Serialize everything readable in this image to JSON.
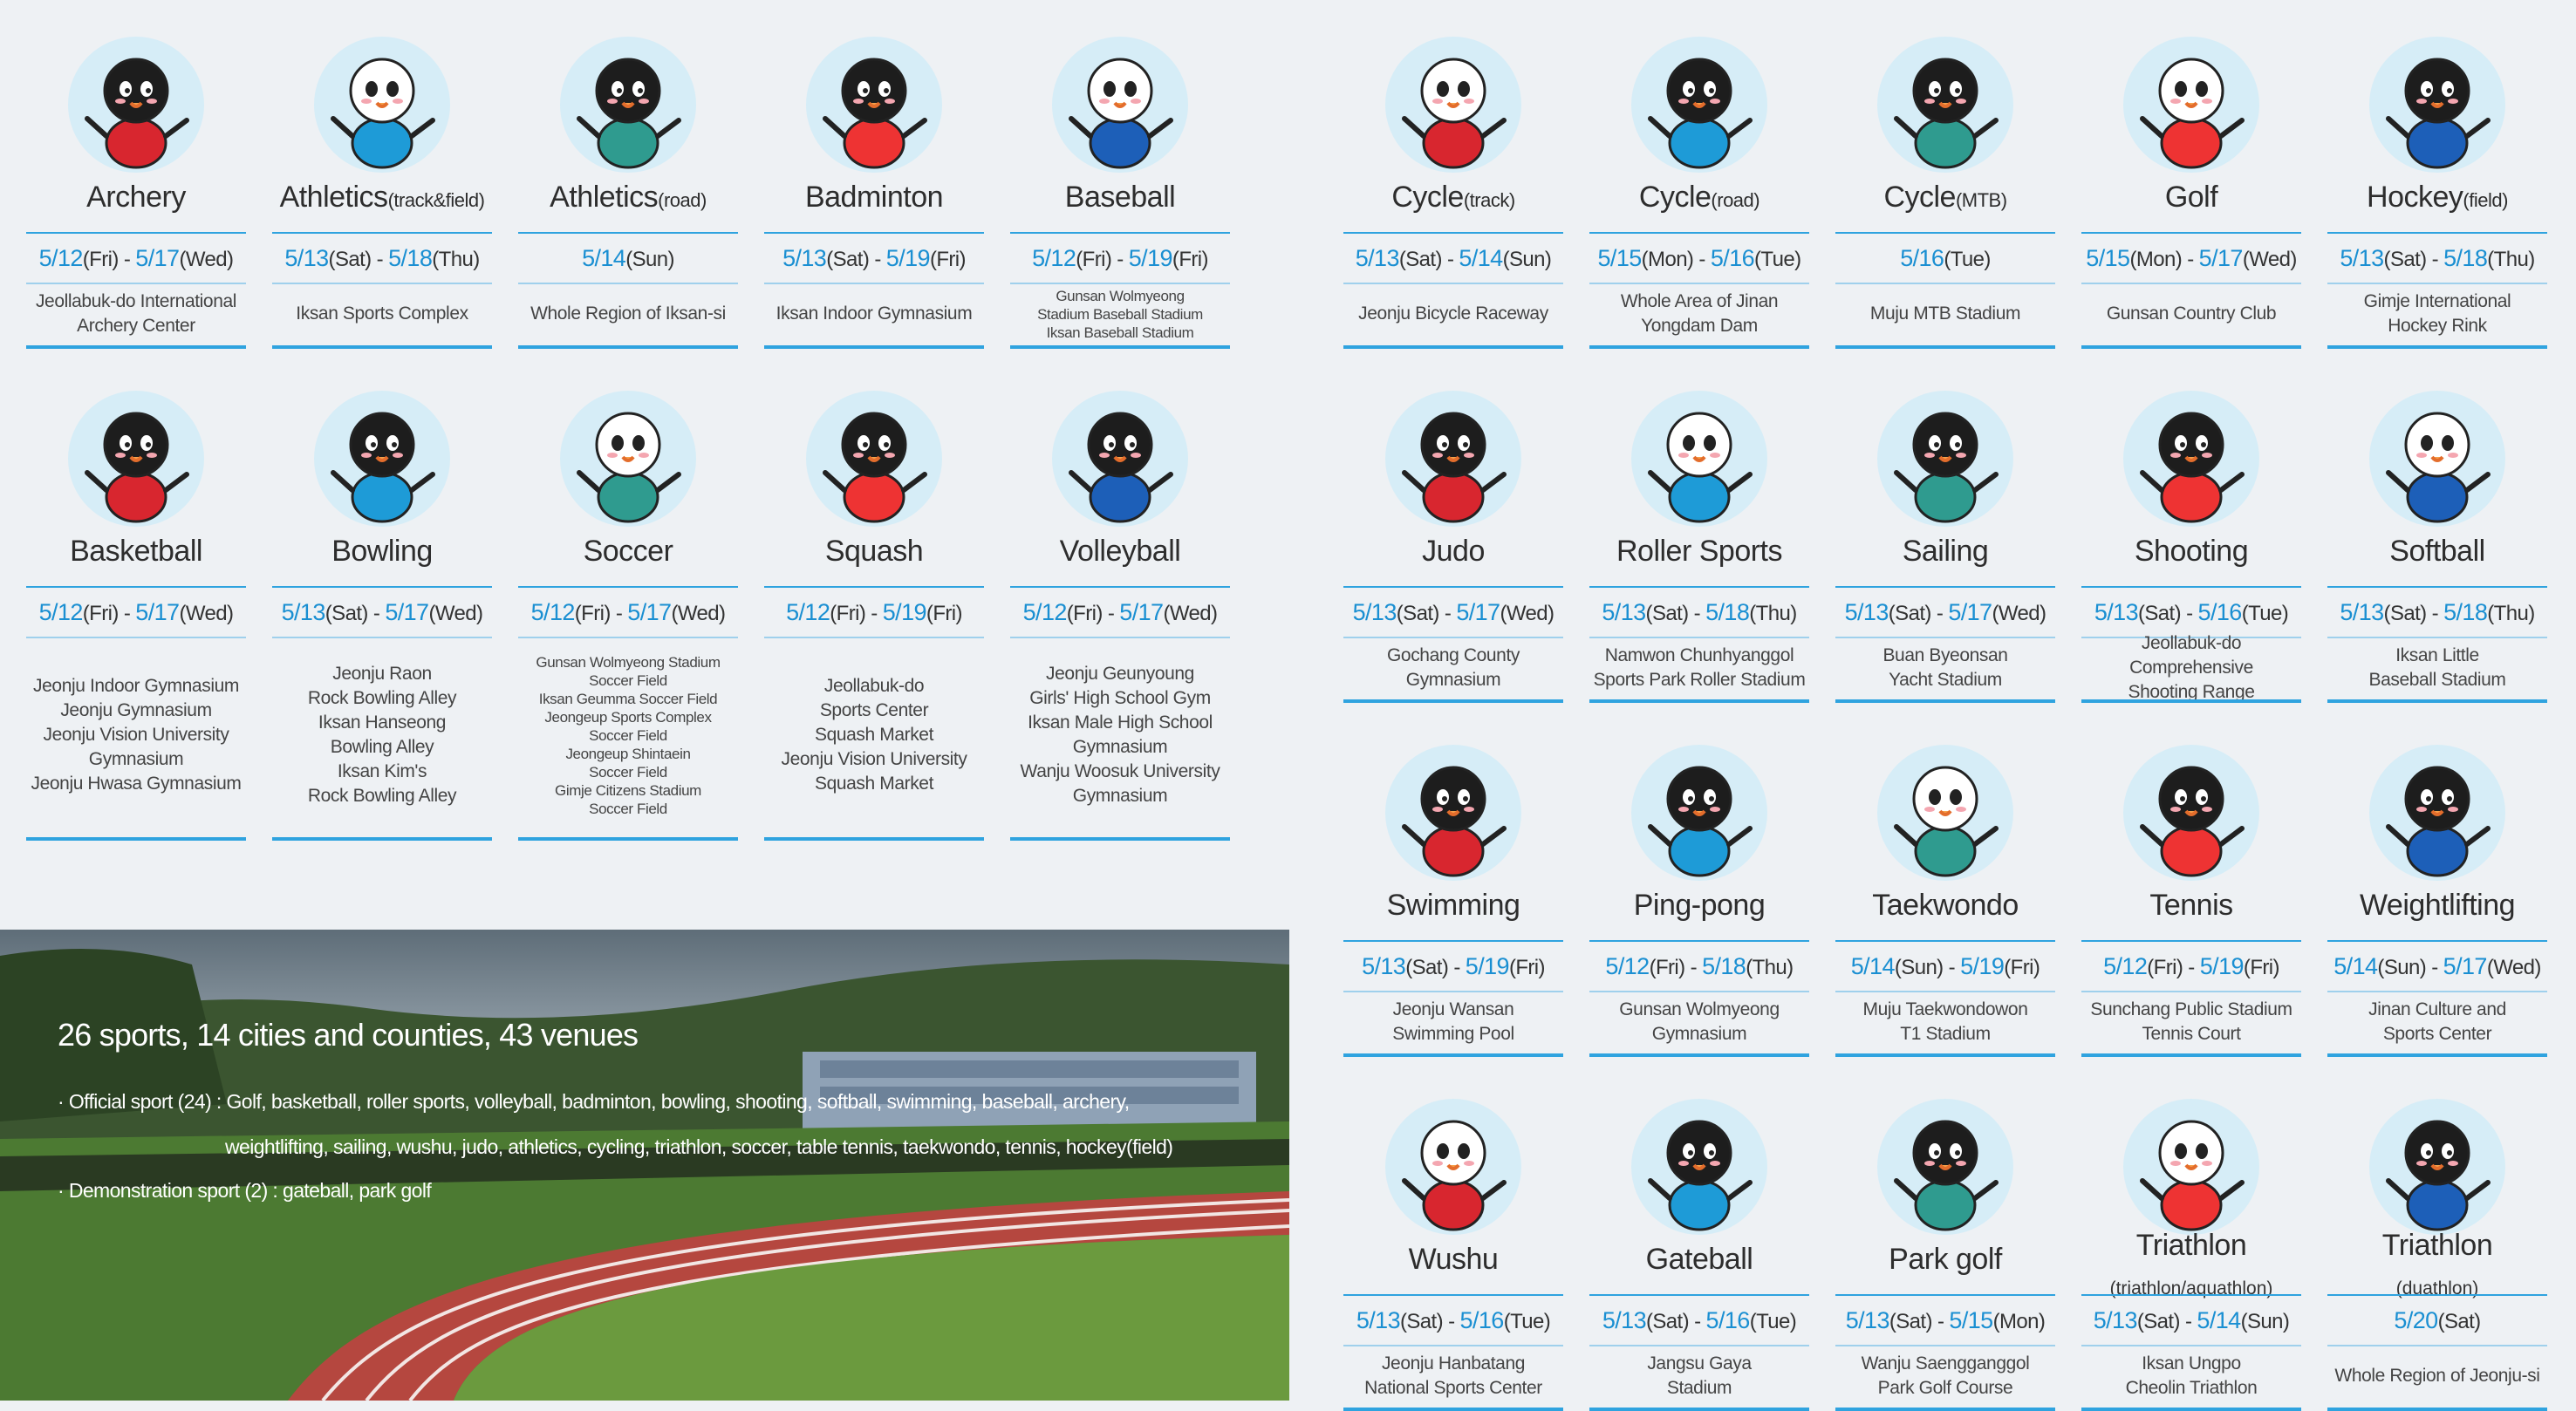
{
  "colors": {
    "accent": "#1a8fd2",
    "background": "#eef1f4"
  },
  "sports": [
    {
      "name": "Archery",
      "suffix": "",
      "start": "5/12",
      "start_day": "(Fri)",
      "end": "5/17",
      "end_day": "(Wed)",
      "venue": "Jeollabuk-do International\nArchery Center",
      "mascot": "archery-mascot-icon"
    },
    {
      "name": "Athletics",
      "suffix": "(track&field)",
      "start": "5/13",
      "start_day": "(Sat)",
      "end": "5/18",
      "end_day": "(Thu)",
      "venue": "Iksan Sports Complex",
      "mascot": "athletics-track-mascot-icon"
    },
    {
      "name": "Athletics",
      "suffix": "(road)",
      "start": "5/14",
      "start_day": "(Sun)",
      "end": "",
      "end_day": "",
      "venue": "Whole Region of Iksan-si",
      "mascot": "athletics-road-mascot-icon"
    },
    {
      "name": "Badminton",
      "suffix": "",
      "start": "5/13",
      "start_day": "(Sat)",
      "end": "5/19",
      "end_day": "(Fri)",
      "venue": "Iksan Indoor Gymnasium",
      "mascot": "badminton-mascot-icon"
    },
    {
      "name": "Baseball",
      "suffix": "",
      "start": "5/12",
      "start_day": "(Fri)",
      "end": "5/19",
      "end_day": "(Fri)",
      "venue": "Gunsan Wolmyeong\nStadium Baseball Stadium\nIksan Baseball Stadium",
      "mascot": "baseball-mascot-icon"
    },
    {
      "name": "Basketball",
      "suffix": "",
      "start": "5/12",
      "start_day": "(Fri)",
      "end": "5/17",
      "end_day": "(Wed)",
      "venue": "Jeonju Indoor Gymnasium\nJeonju Gymnasium\nJeonju Vision University\nGymnasium\nJeonju Hwasa Gymnasium",
      "mascot": "basketball-mascot-icon"
    },
    {
      "name": "Bowling",
      "suffix": "",
      "start": "5/13",
      "start_day": "(Sat)",
      "end": "5/17",
      "end_day": "(Wed)",
      "venue": "Jeonju Raon\nRock Bowling Alley\nIksan Hanseong\nBowling Alley\nIksan Kim's\nRock Bowling Alley",
      "mascot": "bowling-mascot-icon"
    },
    {
      "name": "Soccer",
      "suffix": "",
      "start": "5/12",
      "start_day": "(Fri)",
      "end": "5/17",
      "end_day": "(Wed)",
      "venue": "Gunsan Wolmyeong Stadium\nSoccer Field\nIksan Geumma Soccer Field\nJeongeup Sports Complex\nSoccer Field\nJeongeup Shintaein\nSoccer Field\nGimje Citizens Stadium\nSoccer Field",
      "mascot": "soccer-mascot-icon"
    },
    {
      "name": "Squash",
      "suffix": "",
      "start": "5/12",
      "start_day": "(Fri)",
      "end": "5/19",
      "end_day": "(Fri)",
      "venue": "Jeollabuk-do\nSports Center\nSquash Market\nJeonju Vision University\nSquash Market",
      "mascot": "squash-mascot-icon"
    },
    {
      "name": "Volleyball",
      "suffix": "",
      "start": "5/12",
      "start_day": "(Fri)",
      "end": "5/17",
      "end_day": "(Wed)",
      "venue": "Jeonju Geunyoung\nGirls' High School Gym\nIksan Male High School\nGymnasium\nWanju Woosuk University\nGymnasium",
      "mascot": "volleyball-mascot-icon"
    },
    {
      "name": "Cycle",
      "suffix": "(track)",
      "start": "5/13",
      "start_day": "(Sat)",
      "end": "5/14",
      "end_day": "(Sun)",
      "venue": "Jeonju Bicycle Raceway",
      "mascot": "cycle-track-mascot-icon"
    },
    {
      "name": "Cycle",
      "suffix": "(road)",
      "start": "5/15",
      "start_day": "(Mon)",
      "end": "5/16",
      "end_day": "(Tue)",
      "venue": "Whole Area of Jinan\nYongdam Dam",
      "mascot": "cycle-road-mascot-icon"
    },
    {
      "name": "Cycle",
      "suffix": "(MTB)",
      "start": "5/16",
      "start_day": "(Tue)",
      "end": "",
      "end_day": "",
      "venue": "Muju MTB Stadium",
      "mascot": "cycle-mtb-mascot-icon"
    },
    {
      "name": "Golf",
      "suffix": "",
      "start": "5/15",
      "start_day": "(Mon)",
      "end": "5/17",
      "end_day": "(Wed)",
      "venue": "Gunsan Country Club",
      "mascot": "golf-mascot-icon"
    },
    {
      "name": "Hockey",
      "suffix": "(field)",
      "start": "5/13",
      "start_day": "(Sat)",
      "end": "5/18",
      "end_day": "(Thu)",
      "venue": "Gimje International\nHockey Rink",
      "mascot": "hockey-mascot-icon"
    },
    {
      "name": "Judo",
      "suffix": "",
      "start": "5/13",
      "start_day": "(Sat)",
      "end": "5/17",
      "end_day": "(Wed)",
      "venue": "Gochang County\nGymnasium",
      "mascot": "judo-mascot-icon"
    },
    {
      "name": "Roller Sports",
      "suffix": "",
      "start": "5/13",
      "start_day": "(Sat)",
      "end": "5/18",
      "end_day": "(Thu)",
      "venue": "Namwon Chunhyanggol\nSports Park Roller Stadium",
      "mascot": "roller-sports-mascot-icon"
    },
    {
      "name": "Sailing",
      "suffix": "",
      "start": "5/13",
      "start_day": "(Sat)",
      "end": "5/17",
      "end_day": "(Wed)",
      "venue": "Buan Byeonsan\nYacht Stadium",
      "mascot": "sailing-mascot-icon"
    },
    {
      "name": "Shooting",
      "suffix": "",
      "start": "5/13",
      "start_day": "(Sat)",
      "end": "5/16",
      "end_day": "(Tue)",
      "venue": "Jeollabuk-do Comprehensive\nShooting Range",
      "mascot": "shooting-mascot-icon"
    },
    {
      "name": "Softball",
      "suffix": "",
      "start": "5/13",
      "start_day": "(Sat)",
      "end": "5/18",
      "end_day": "(Thu)",
      "venue": "Iksan Little\nBaseball Stadium",
      "mascot": "softball-mascot-icon"
    },
    {
      "name": "Swimming",
      "suffix": "",
      "start": "5/13",
      "start_day": "(Sat)",
      "end": "5/19",
      "end_day": "(Fri)",
      "venue": "Jeonju Wansan\nSwimming Pool",
      "mascot": "swimming-mascot-icon"
    },
    {
      "name": "Ping-pong",
      "suffix": "",
      "start": "5/12",
      "start_day": "(Fri)",
      "end": "5/18",
      "end_day": "(Thu)",
      "venue": "Gunsan Wolmyeong\nGymnasium",
      "mascot": "ping-pong-mascot-icon"
    },
    {
      "name": "Taekwondo",
      "suffix": "",
      "start": "5/14",
      "start_day": "(Sun)",
      "end": "5/19",
      "end_day": "(Fri)",
      "venue": "Muju Taekwondowon\nT1 Stadium",
      "mascot": "taekwondo-mascot-icon"
    },
    {
      "name": "Tennis",
      "suffix": "",
      "start": "5/12",
      "start_day": "(Fri)",
      "end": "5/19",
      "end_day": "(Fri)",
      "venue": "Sunchang Public Stadium\nTennis Court",
      "mascot": "tennis-mascot-icon"
    },
    {
      "name": "Weightlifting",
      "suffix": "",
      "start": "5/14",
      "start_day": "(Sun)",
      "end": "5/17",
      "end_day": "(Wed)",
      "venue": "Jinan Culture and\nSports Center",
      "mascot": "weightlifting-mascot-icon"
    },
    {
      "name": "Wushu",
      "suffix": "",
      "start": "5/13",
      "start_day": "(Sat)",
      "end": "5/16",
      "end_day": "(Tue)",
      "venue": "Jeonju Hanbatang\nNational Sports Center",
      "mascot": "wushu-mascot-icon"
    },
    {
      "name": "Gateball",
      "suffix": "",
      "start": "5/13",
      "start_day": "(Sat)",
      "end": "5/16",
      "end_day": "(Tue)",
      "venue": "Jangsu Gaya\nStadium",
      "mascot": "gateball-mascot-icon"
    },
    {
      "name": "Park golf",
      "suffix": "",
      "start": "5/13",
      "start_day": "(Sat)",
      "end": "5/15",
      "end_day": "(Mon)",
      "venue": "Wanju Saengganggol\nPark Golf Course",
      "mascot": "park-golf-mascot-icon"
    },
    {
      "name": "Triathlon",
      "suffix": "",
      "sub": "(triathlon/aquathlon)",
      "start": "5/13",
      "start_day": "(Sat)",
      "end": "5/14",
      "end_day": "(Sun)",
      "venue": "Iksan Ungpo\nCheolin Triathlon",
      "mascot": "triathlon-mascot-icon"
    },
    {
      "name": "Triathlon",
      "suffix": "",
      "sub": "(duathlon)",
      "start": "5/20",
      "start_day": "(Sat)",
      "end": "",
      "end_day": "",
      "venue": "Whole Region of Jeonju-si",
      "mascot": "duathlon-mascot-icon"
    }
  ],
  "summary": {
    "title": "26 sports, 14 cities and counties, 43 venues",
    "line1": "· Official sport (24) : Golf, basketball, roller sports, volleyball, badminton, bowling, shooting, softball, swimming, baseball, archery,",
    "line2": "weightlifting, sailing, wushu, judo, athletics, cycling, triathlon, soccer, table tennis, taekwondo, tennis, hockey(field)",
    "line3": "· Demonstration sport (2) : gateball, park golf"
  }
}
